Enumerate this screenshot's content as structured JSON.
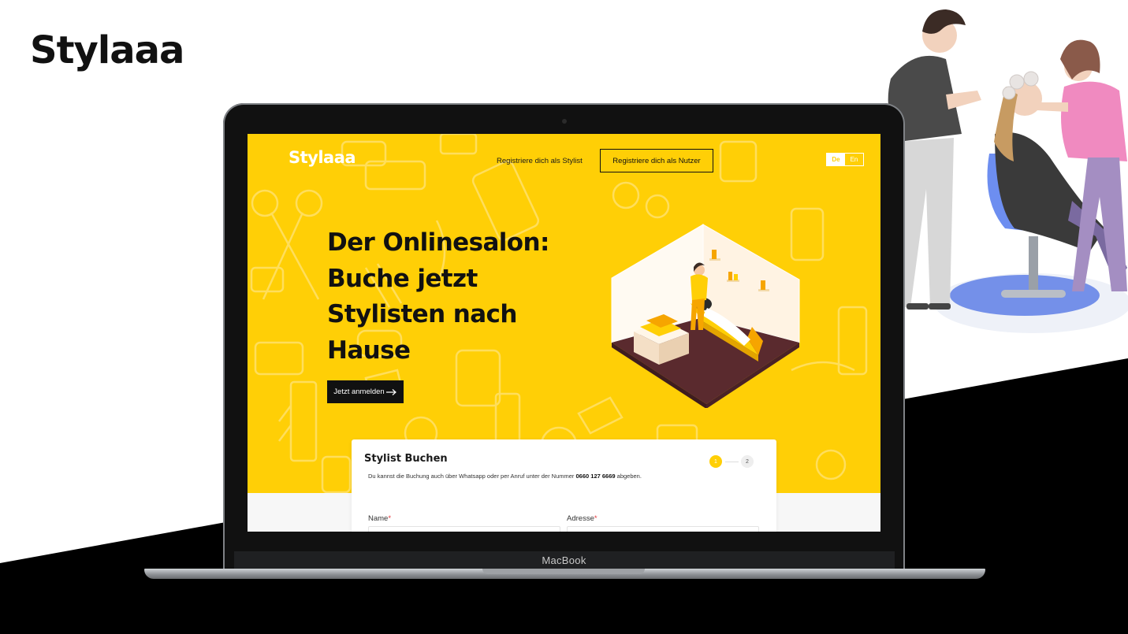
{
  "brand": {
    "logo_text": "Stylaaa"
  },
  "device": {
    "label": "MacBook"
  },
  "site": {
    "logo": "Stylaaa",
    "nav": {
      "register_stylist": "Registriere dich als Stylist",
      "register_user": "Registriere dich als Nutzer"
    },
    "lang": {
      "de": "De",
      "en": "En",
      "active": "De"
    },
    "hero": {
      "title_lines": [
        "Der Onlinesalon:",
        "Buche jetzt",
        "Stylisten nach",
        "Hause"
      ],
      "cta": "Jetzt anmelden"
    },
    "booking": {
      "title": "Stylist Buchen",
      "desc_prefix": "Du kannst die Buchung auch über Whatsapp oder per Anruf unter der Nummer",
      "phone": "0660 127 6669",
      "desc_suffix": "abgeben.",
      "steps": [
        "1",
        "2"
      ],
      "fields": {
        "name": "Name",
        "adresse": "Adresse",
        "required_mark": "*"
      }
    }
  },
  "colors": {
    "accent": "#ffcf06",
    "dark": "#111111",
    "floor": "#5a2a2e",
    "required": "#e5383b"
  }
}
